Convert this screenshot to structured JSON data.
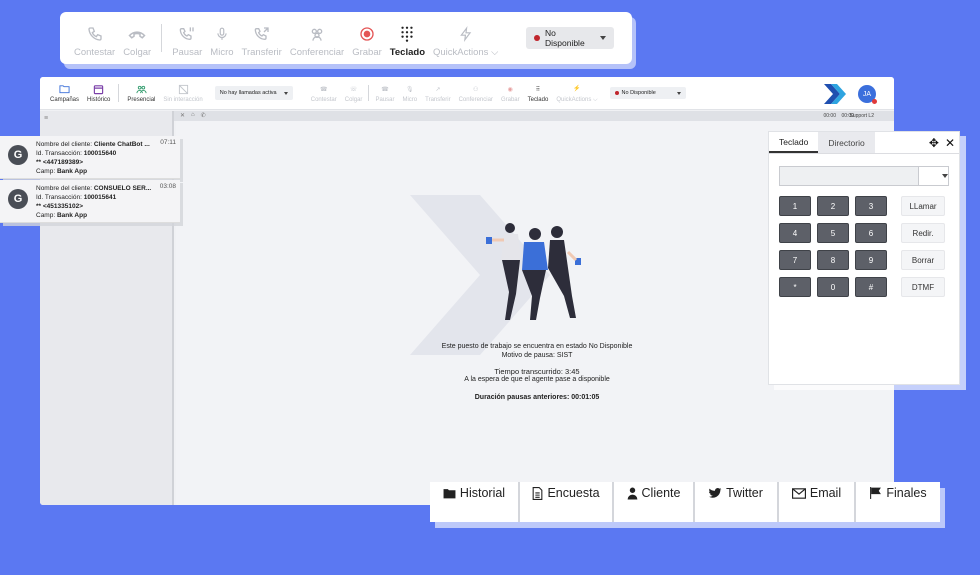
{
  "toolbar": {
    "items": [
      {
        "label": "Contestar"
      },
      {
        "label": "Colgar"
      },
      {
        "label": "Pausar"
      },
      {
        "label": "Micro"
      },
      {
        "label": "Transferir"
      },
      {
        "label": "Conferenciar"
      },
      {
        "label": "Grabar"
      },
      {
        "label": "Teclado"
      },
      {
        "label": "QuickActions"
      }
    ],
    "status": "No Disponible"
  },
  "app": {
    "nav": {
      "campaigns": "Campañas",
      "history": "Histórico",
      "presence": "Presencial",
      "no_interaction": "Sin interacción"
    },
    "call_state": "No hay llamadas activa",
    "mini_items": [
      "Contestar",
      "Colgar",
      "Pausar",
      "Micro",
      "Transferir",
      "Conferenciar",
      "Grabar",
      "Teclado",
      "QuickActions"
    ],
    "mini_status": "No Disponible",
    "avatar": "JA",
    "subbar": {
      "t1": "00:00",
      "t2": "00:00",
      "t3": "Support L2"
    }
  },
  "notifications": [
    {
      "name_label": "Nombre del cliente:",
      "name": "Cliente ChatBot ...",
      "tx_label": "Id. Transacción:",
      "tx": "100015640",
      "phone": "** <447189389>",
      "camp_label": "Camp:",
      "camp": "Bank App",
      "time": "07:11"
    },
    {
      "name_label": "Nombre del cliente:",
      "name": "CONSUELO SER...",
      "tx_label": "Id. Transacción:",
      "tx": "100015641",
      "phone": "** <451335102>",
      "camp_label": "Camp:",
      "camp": "Bank App",
      "time": "03:08"
    }
  ],
  "empty_state": {
    "line1": "Este puesto de trabajo se encuentra en estado No Disponible",
    "line2": "Motivo de pausa: SIST",
    "elapsed": "Tiempo transcurrido:   3:45",
    "waiting": "A la espera de que el agente pase a disponible",
    "previous": "Duración pausas anteriores: 00:01:05"
  },
  "keypad": {
    "tabs": [
      "Teclado",
      "Directorio"
    ],
    "keys": [
      "1",
      "2",
      "3",
      "LLamar",
      "4",
      "5",
      "6",
      "Redir.",
      "7",
      "8",
      "9",
      "Borrar",
      "*",
      "0",
      "#",
      "DTMF"
    ]
  },
  "bottom_tabs": [
    "Historial",
    "Encuesta",
    "Cliente",
    "Twitter",
    "Email",
    "Finales"
  ]
}
